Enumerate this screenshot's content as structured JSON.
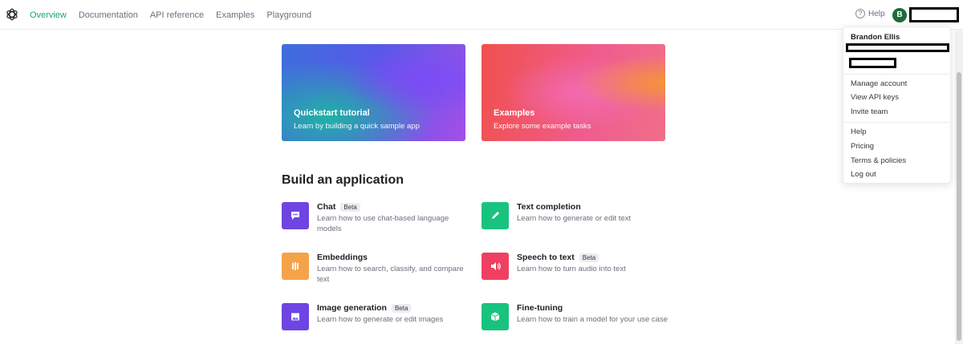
{
  "nav": {
    "items": [
      {
        "label": "Overview",
        "active": true
      },
      {
        "label": "Documentation",
        "active": false
      },
      {
        "label": "API reference",
        "active": false
      },
      {
        "label": "Examples",
        "active": false
      },
      {
        "label": "Playground",
        "active": false
      }
    ],
    "help_label": "Help",
    "help_glyph": "?",
    "avatar_initial": "B"
  },
  "cards": [
    {
      "title": "Quickstart tutorial",
      "subtitle": "Learn by building a quick sample app"
    },
    {
      "title": "Examples",
      "subtitle": "Explore some example tasks"
    }
  ],
  "section_title": "Build an application",
  "apps": [
    {
      "name": "Chat",
      "badge": "Beta",
      "desc": "Learn how to use chat-based language models",
      "icon": "chat-icon",
      "color": "#6e45e2"
    },
    {
      "name": "Text completion",
      "badge": "",
      "desc": "Learn how to generate or edit text",
      "icon": "pencil-icon",
      "color": "#19c37d"
    },
    {
      "name": "Embeddings",
      "badge": "",
      "desc": "Learn how to search, classify, and compare text",
      "icon": "bars-icon",
      "color": "#f4a34a"
    },
    {
      "name": "Speech to text",
      "badge": "Beta",
      "desc": "Learn how to turn audio into text",
      "icon": "speaker-icon",
      "color": "#ef4061"
    },
    {
      "name": "Image generation",
      "badge": "Beta",
      "desc": "Learn how to generate or edit images",
      "icon": "image-icon",
      "color": "#6e45e2"
    },
    {
      "name": "Fine-tuning",
      "badge": "",
      "desc": "Learn how to train a model for your use case",
      "icon": "cube-icon",
      "color": "#19c37d"
    }
  ],
  "menu": {
    "user_name": "Brandon Ellis",
    "group1": [
      "Manage account",
      "View API keys",
      "Invite team"
    ],
    "group2": [
      "Help",
      "Pricing",
      "Terms & policies",
      "Log out"
    ]
  },
  "colors": {
    "accent": "#10a37f",
    "avatar": "#1e6b3a"
  }
}
